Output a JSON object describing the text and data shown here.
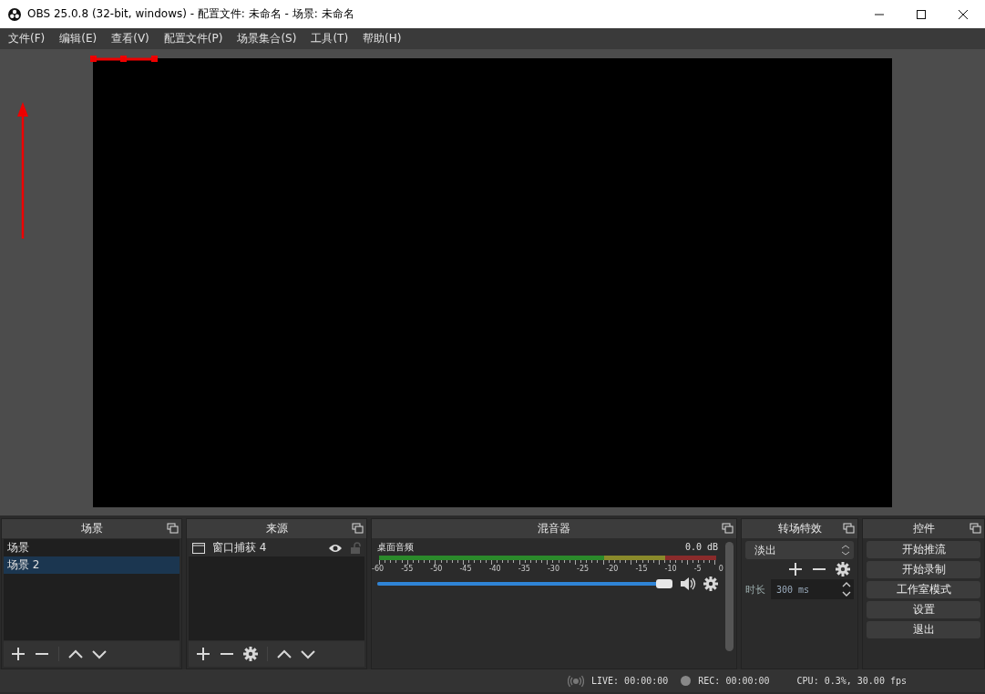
{
  "window": {
    "title": "OBS 25.0.8 (32-bit, windows) - 配置文件: 未命名 - 场景: 未命名"
  },
  "menu": [
    "文件(F)",
    "编辑(E)",
    "查看(V)",
    "配置文件(P)",
    "场景集合(S)",
    "工具(T)",
    "帮助(H)"
  ],
  "scenes": {
    "title": "场景",
    "items": [
      {
        "label": "场景",
        "selected": false
      },
      {
        "label": "场景 2",
        "selected": true
      }
    ]
  },
  "sources": {
    "title": "来源",
    "items": [
      {
        "label": "窗口捕获 4",
        "visible": true,
        "locked": false,
        "selected": false
      }
    ]
  },
  "mixer": {
    "title": "混音器",
    "channels": [
      {
        "name": "桌面音频",
        "reading": "0.0 dB",
        "level": 1,
        "ticks": [
          "-60",
          "-55",
          "-50",
          "-45",
          "-40",
          "-35",
          "-30",
          "-25",
          "-20",
          "-15",
          "-10",
          "-5",
          "0"
        ]
      }
    ]
  },
  "transitions": {
    "title": "转场特效",
    "value": "淡出",
    "duration_label": "时长",
    "duration": "300 ms"
  },
  "controls": {
    "title": "控件",
    "buttons": [
      "开始推流",
      "开始录制",
      "工作室模式",
      "设置",
      "退出"
    ]
  },
  "status_bar": {
    "live": "LIVE: 00:00:00",
    "rec": "REC: 00:00:00",
    "cpu": "CPU: 0.3%, 30.00 fps"
  }
}
